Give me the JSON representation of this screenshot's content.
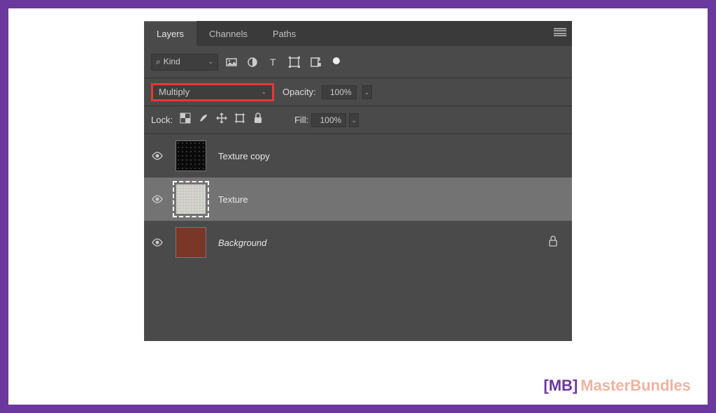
{
  "tabs": {
    "layers": "Layers",
    "channels": "Channels",
    "paths": "Paths"
  },
  "filter": {
    "kind": "Kind"
  },
  "blend": {
    "mode": "Multiply",
    "opacity_label": "Opacity:",
    "opacity_value": "100%"
  },
  "lock": {
    "label": "Lock:",
    "fill_label": "Fill:",
    "fill_value": "100%"
  },
  "layers": {
    "l1": "Texture copy",
    "l2": "Texture",
    "l3": "Background"
  },
  "watermark": {
    "open": "[",
    "mb": "MB",
    "close": "]",
    "text": "MasterBundles"
  }
}
